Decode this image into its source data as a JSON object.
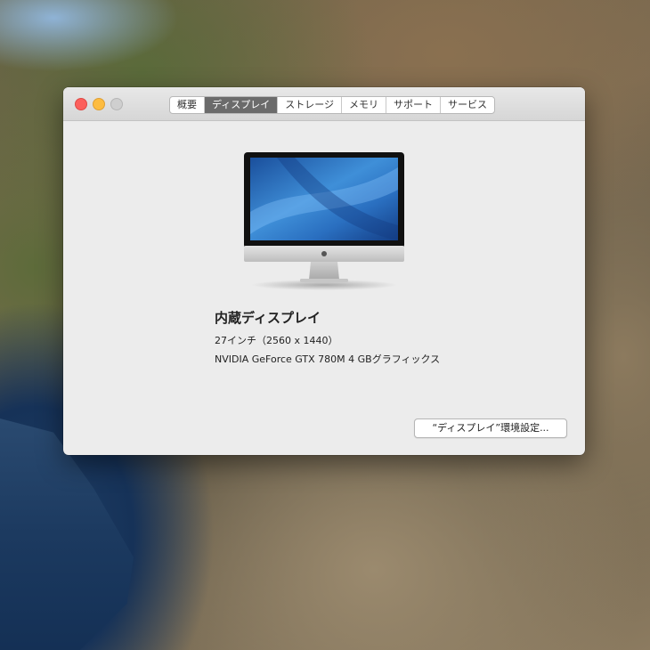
{
  "tabs": [
    "概要",
    "ディスプレイ",
    "ストレージ",
    "メモリ",
    "サポート",
    "サービス"
  ],
  "active_tab": "ディスプレイ",
  "display": {
    "title": "内蔵ディスプレイ",
    "size_resolution": "27インチ（2560 x 1440）",
    "graphics": "NVIDIA GeForce GTX 780M 4 GBグラフィックス"
  },
  "prefs_button": "“ディスプレイ”環境設定..."
}
